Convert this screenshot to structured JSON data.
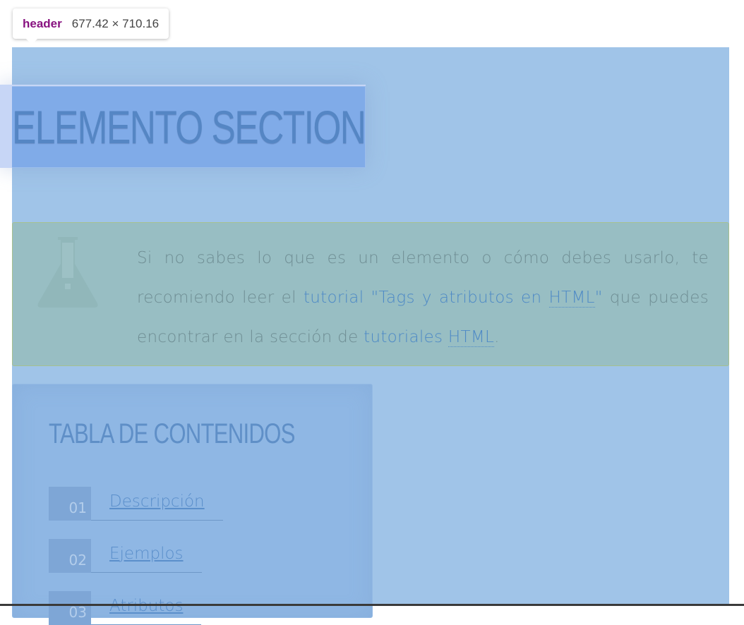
{
  "devtools": {
    "tag": "header",
    "size": "677.42 × 710.16"
  },
  "header": {
    "title": "ELEMENTO SECTION"
  },
  "note": {
    "icon": "flask-icon",
    "text_1": "Si no sabes lo que es un elemento o cómo debes usarlo, te recomiendo leer el ",
    "link_1": "tutorial \"Tags y atributos en ",
    "link_1_abbr": "HTML",
    "link_1_end": "\"",
    "text_2": " que puedes encontrar en la sección de ",
    "link_2": "tutoriales ",
    "link_2_abbr": "HTML",
    "text_3": "."
  },
  "toc": {
    "title": "TABLA DE CONTENIDOS",
    "items": [
      {
        "num": "01",
        "label": "Descripción"
      },
      {
        "num": "02",
        "label": "Ejemplos"
      },
      {
        "num": "03",
        "label": "Atributos"
      }
    ]
  },
  "colors": {
    "header_overlay": "#a0c4e8",
    "tooltip_tag": "#881280"
  }
}
